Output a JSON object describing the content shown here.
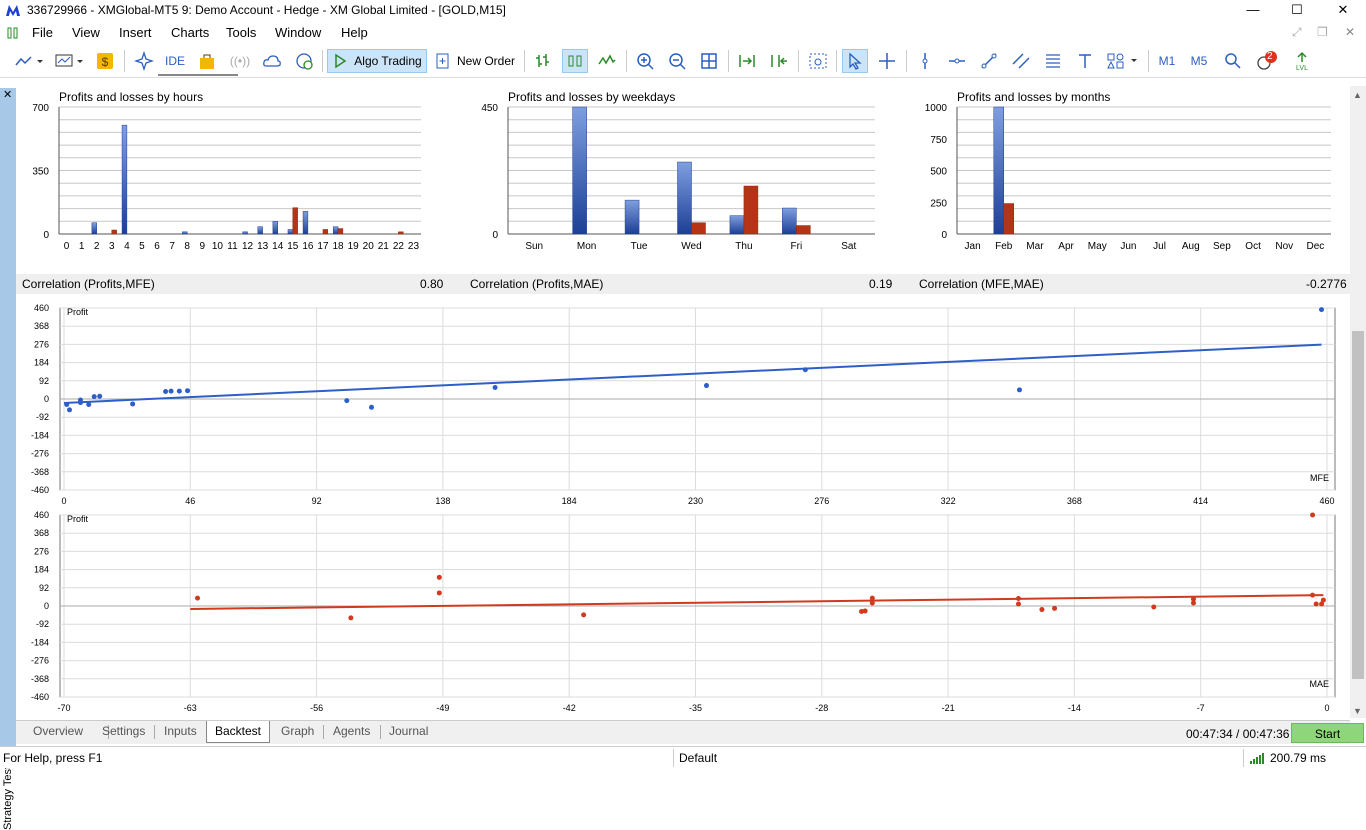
{
  "window": {
    "title": "336729966 - XMGlobal-MT5 9: Demo Account - Hedge - XM Global Limited - [GOLD,M15]",
    "minimize": "—",
    "maximize": "☐",
    "close": "✕"
  },
  "menu": [
    "File",
    "View",
    "Insert",
    "Charts",
    "Tools",
    "Window",
    "Help"
  ],
  "toolbar": {
    "ide": "IDE",
    "algo_trading": "Algo Trading",
    "new_order": "New Order",
    "m1": "M1",
    "m5": "M5",
    "notifications": "2"
  },
  "charts_top": [
    {
      "title": "Profits and losses by hours",
      "ylim": [
        0,
        700
      ],
      "yticks": [
        "700",
        "350",
        "0"
      ],
      "categories": [
        "0",
        "1",
        "2",
        "3",
        "4",
        "5",
        "6",
        "7",
        "8",
        "9",
        "10",
        "11",
        "12",
        "13",
        "14",
        "15",
        "16",
        "17",
        "18",
        "19",
        "20",
        "21",
        "22",
        "23"
      ],
      "profit": [
        0,
        0,
        62,
        0,
        600,
        0,
        0,
        0,
        12,
        0,
        0,
        0,
        12,
        40,
        70,
        25,
        125,
        0,
        40,
        0,
        0,
        0,
        0,
        0
      ],
      "loss": [
        0,
        0,
        0,
        22,
        0,
        0,
        0,
        0,
        0,
        0,
        0,
        0,
        0,
        0,
        0,
        145,
        0,
        25,
        30,
        0,
        0,
        0,
        12,
        0
      ]
    },
    {
      "title": "Profits and losses by weekdays",
      "ylim": [
        0,
        450
      ],
      "yticks": [
        "450",
        "0"
      ],
      "categories": [
        "Sun",
        "Mon",
        "Tue",
        "Wed",
        "Thu",
        "Fri",
        "Sat"
      ],
      "profit": [
        0,
        450,
        120,
        255,
        65,
        92,
        0
      ],
      "loss": [
        0,
        0,
        0,
        40,
        170,
        30,
        0
      ]
    },
    {
      "title": "Profits and losses by months",
      "ylim": [
        0,
        1000
      ],
      "yticks": [
        "1000",
        "750",
        "500",
        "250",
        "0"
      ],
      "categories": [
        "Jan",
        "Feb",
        "Mar",
        "Apr",
        "May",
        "Jun",
        "Jul",
        "Aug",
        "Sep",
        "Oct",
        "Nov",
        "Dec"
      ],
      "profit": [
        0,
        1000,
        0,
        0,
        0,
        0,
        0,
        0,
        0,
        0,
        0,
        0
      ],
      "loss": [
        0,
        240,
        0,
        0,
        0,
        0,
        0,
        0,
        0,
        0,
        0,
        0
      ]
    }
  ],
  "correlations": [
    {
      "label": "Correlation (Profits,MFE)",
      "value": "0.80"
    },
    {
      "label": "Correlation (Profits,MAE)",
      "value": "0.19"
    },
    {
      "label": "Correlation (MFE,MAE)",
      "value": "-0.2776"
    }
  ],
  "chart_data": [
    {
      "type": "scatter",
      "ylabel": "Profit",
      "xlabel": "MFE",
      "ylim": [
        -460,
        460
      ],
      "xlim": [
        0,
        460
      ],
      "yticks": [
        "460",
        "368",
        "276",
        "184",
        "92",
        "0",
        "-92",
        "-184",
        "-276",
        "-368",
        "-460"
      ],
      "xticks": [
        "0",
        "46",
        "92",
        "138",
        "184",
        "230",
        "276",
        "322",
        "368",
        "414",
        "460"
      ],
      "color": "#2e5fc8",
      "points": [
        [
          1,
          -28
        ],
        [
          2,
          -55
        ],
        [
          6,
          -18
        ],
        [
          6,
          -5
        ],
        [
          9,
          -28
        ],
        [
          11,
          12
        ],
        [
          13,
          14
        ],
        [
          25,
          -25
        ],
        [
          37,
          38
        ],
        [
          39,
          40
        ],
        [
          42,
          40
        ],
        [
          45,
          42
        ],
        [
          103,
          -8
        ],
        [
          112,
          -42
        ],
        [
          157,
          58
        ],
        [
          234,
          68
        ],
        [
          270,
          148
        ],
        [
          348,
          46
        ],
        [
          458,
          452
        ]
      ],
      "trend": [
        [
          0,
          -20
        ],
        [
          458,
          275
        ]
      ]
    },
    {
      "type": "scatter",
      "ylabel": "Profit",
      "xlabel": "MAE",
      "ylim": [
        -460,
        460
      ],
      "xlim": [
        -70,
        0
      ],
      "yticks": [
        "460",
        "368",
        "276",
        "184",
        "92",
        "0",
        "-92",
        "-184",
        "-276",
        "-368",
        "-460"
      ],
      "xticks": [
        "-70",
        "-63",
        "-56",
        "-49",
        "-42",
        "-35",
        "-28",
        "-21",
        "-14",
        "-7",
        "0"
      ],
      "color": "#d03a1e",
      "points": [
        [
          -62.6,
          40
        ],
        [
          -54.1,
          -60
        ],
        [
          -49.2,
          145
        ],
        [
          -49.2,
          66
        ],
        [
          -41.2,
          -45
        ],
        [
          -25.8,
          -28
        ],
        [
          -25.6,
          -25
        ],
        [
          -25.2,
          40
        ],
        [
          -25.2,
          15
        ],
        [
          -17.1,
          38
        ],
        [
          -17.1,
          10
        ],
        [
          -15.8,
          -18
        ],
        [
          -15.1,
          -12
        ],
        [
          -9.6,
          -5
        ],
        [
          -7.4,
          15
        ],
        [
          -7.4,
          35
        ],
        [
          -0.8,
          460
        ],
        [
          -0.8,
          55
        ],
        [
          -0.6,
          10
        ],
        [
          -0.3,
          10
        ],
        [
          -0.2,
          30
        ]
      ],
      "trend": [
        [
          -63,
          -15
        ],
        [
          -0.2,
          55
        ]
      ]
    }
  ],
  "tabs": [
    "Overview",
    "Settings",
    "Inputs",
    "Backtest",
    "Graph",
    "Agents",
    "Journal"
  ],
  "active_tab": "Backtest",
  "tester": {
    "vertical_label": "Strategy Tester",
    "timer": "00:47:34 / 00:47:36",
    "start": "Start"
  },
  "status": {
    "help": "For Help, press F1",
    "profile": "Default",
    "ping": "200.79 ms"
  }
}
